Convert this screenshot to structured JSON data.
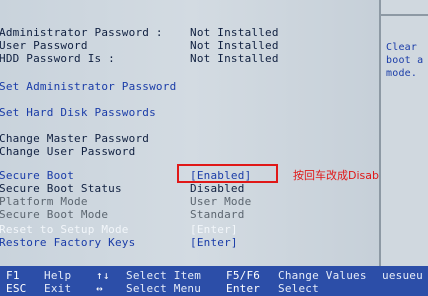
{
  "rows": {
    "admin_pw_label": "Administrator Password :",
    "admin_pw_value": "Not Installed",
    "user_pw_label": "User Password",
    "user_pw_value": "Not Installed",
    "hdd_pw_label": "HDD Password Is :",
    "hdd_pw_value": "Not Installed",
    "set_admin_pw": "Set Administrator Password",
    "set_hdd_pw": "Set Hard Disk Passwords",
    "change_master_pw": "Change Master Password",
    "change_user_pw": "Change User Password",
    "secure_boot_label": "Secure Boot",
    "secure_boot_value": "[Enabled]",
    "secure_boot_status_label": "Secure Boot Status",
    "secure_boot_status_value": "Disabled",
    "platform_mode_label": "Platform Mode",
    "platform_mode_value": "User Mode",
    "secure_boot_mode_label": "Secure Boot Mode",
    "secure_boot_mode_value": "Standard",
    "reset_setup_label": "Reset to Setup Mode",
    "reset_setup_value": "[Enter]",
    "restore_keys_label": "Restore Factory Keys",
    "restore_keys_value": "[Enter]"
  },
  "help": {
    "line1": "Clear",
    "line2": "boot a",
    "line3": "mode."
  },
  "annotation": "按回车改成Disabled",
  "footer": {
    "f1_key": "F1",
    "f1_desc": "Help",
    "arrows_key": "↑↓",
    "arrows_desc": "Select Item",
    "f5f6_key": "F5/F6",
    "f5f6_desc": "Change Values",
    "esc_key": "ESC",
    "esc_desc": "Exit",
    "lr_key": "↔",
    "lr_desc": "Select Menu",
    "enter_key": "Enter",
    "enter_desc": "Select",
    "cut_text": "uesueu"
  },
  "colors": {
    "background": "#c9d3dc",
    "text_dark": "#102040",
    "text_blue": "#1a3ca8",
    "text_grey": "#5c6670",
    "footer_bg": "#2c4ea8",
    "annotation_red": "#e01818"
  }
}
